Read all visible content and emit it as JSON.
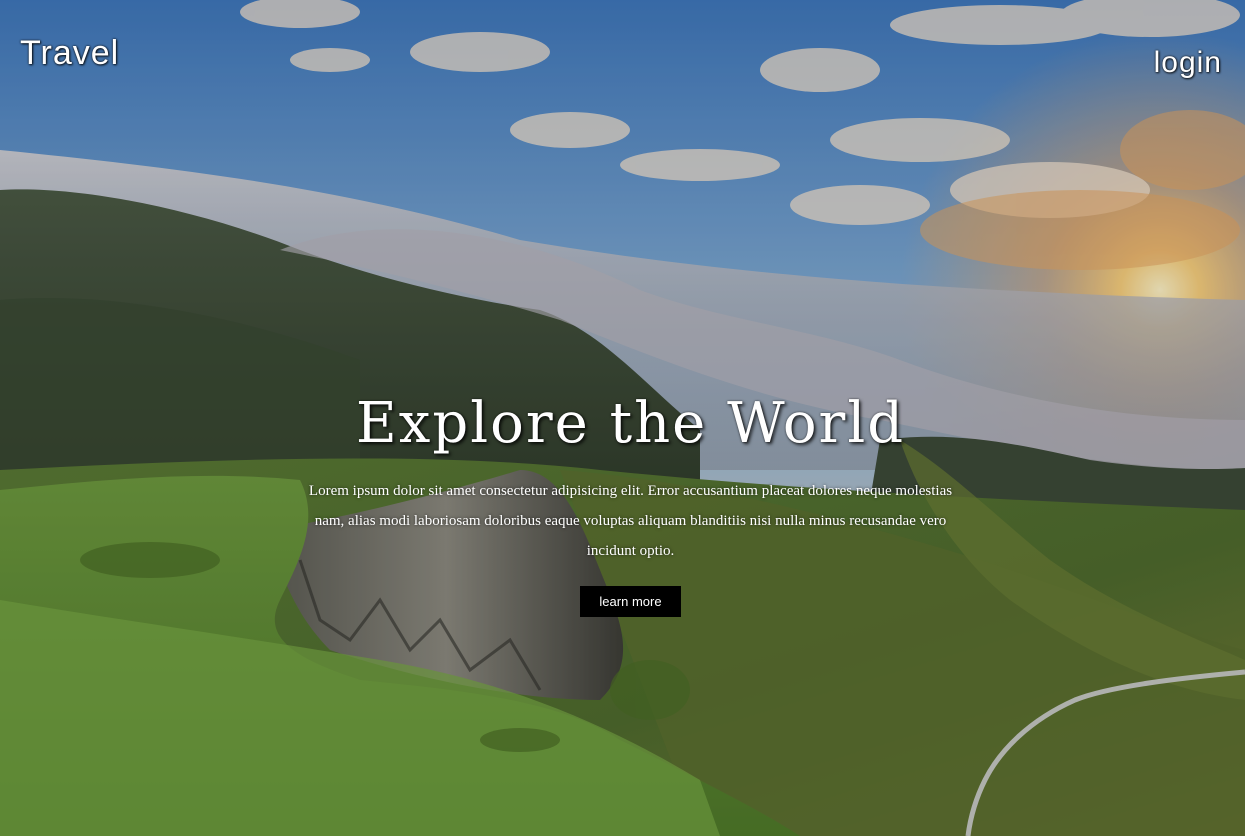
{
  "header": {
    "brand": "Travel",
    "login_label": "login"
  },
  "hero": {
    "headline": "Explore the World",
    "description": "Lorem ipsum dolor sit amet consectetur adipisicing elit. Error accusantium placeat dolores neque molestias nam, alias modi laboriosam doloribus eaque voluptas aliquam blanditiis nisi nulla minus recusandae vero incidunt optio.",
    "button_label": "learn more",
    "background": "mountain-valley-sunrise-photo"
  },
  "colors": {
    "text": "#ffffff",
    "button_bg": "#000000",
    "sky_top": "#4f86c6",
    "sun": "#ffd27a",
    "grass": "#5f8a3a"
  }
}
